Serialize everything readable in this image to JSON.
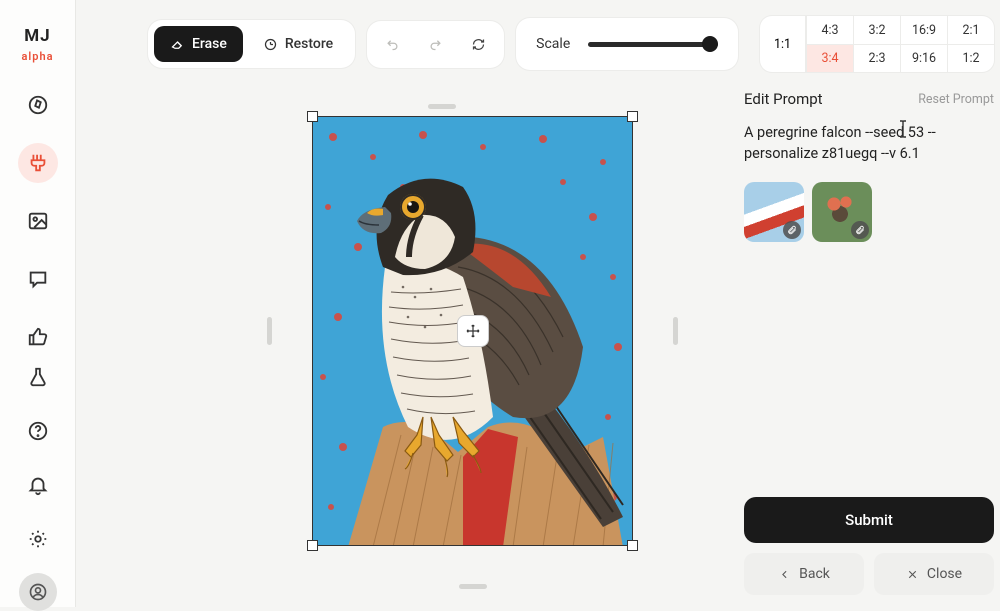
{
  "logo": {
    "main": "MJ",
    "sub": "alpha"
  },
  "toolbar": {
    "erase": "Erase",
    "restore": "Restore",
    "scale_label": "Scale"
  },
  "aspect": {
    "oneone": "1:1",
    "cells": [
      "4:3",
      "3:2",
      "16:9",
      "2:1",
      "3:4",
      "2:3",
      "9:16",
      "1:2"
    ],
    "active_index": 4
  },
  "panel": {
    "title": "Edit Prompt",
    "reset": "Reset Prompt",
    "prompt": "A peregrine falcon  --seed 53 --personalize z81uegq --v 6.1"
  },
  "actions": {
    "submit": "Submit",
    "back": "Back",
    "close": "Close"
  }
}
